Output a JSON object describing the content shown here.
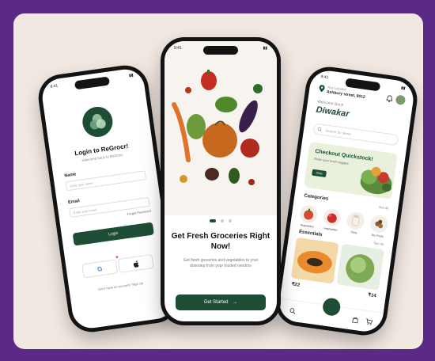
{
  "left_phone": {
    "status_time": "9:41",
    "title": "Login to ReGrocr!",
    "subtitle": "Welcome back to ReGrocr",
    "name_label": "Name",
    "name_placeholder": "Enter your name",
    "email_label": "Email",
    "email_placeholder": "Enter your email",
    "forgot": "Forgot Password",
    "login_button": "Login",
    "google_glyph": "G",
    "apple_glyph": "",
    "signup_text": "Don't have an account? Sign Up"
  },
  "center_phone": {
    "status_time": "9:41",
    "title": "Get Fresh Groceries Right Now!",
    "description": "Get fresh groceries and vegetables to your doorstep from your trusted vendors",
    "button": "Get Started",
    "arrow": "→"
  },
  "right_phone": {
    "status_time": "9:41",
    "location_label": "Your Location",
    "location_value": "Ashbury street, 8012",
    "welcome": "Welcome Back",
    "username": "Diwakar",
    "search_placeholder": "Search for items",
    "promo_title": "Checkout Quickstock!",
    "promo_sub": "Order your fresh veggies",
    "promo_button": "Shop",
    "categories_title": "Categories",
    "see_all": "See All",
    "categories": [
      "Vegetables",
      "Vegetables",
      "Dairy",
      "Dry Fruits"
    ],
    "essentials_title": "Essentials",
    "prices": [
      "₹22",
      "₹14"
    ]
  },
  "colors": {
    "brand_green": "#1e4d36",
    "background": "#f2e8e2",
    "frame": "#5a2a86"
  }
}
